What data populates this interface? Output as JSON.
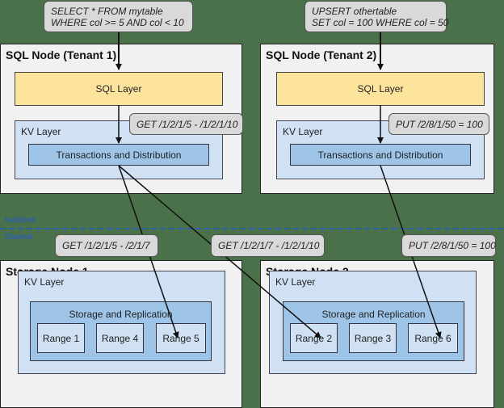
{
  "queries": {
    "tenant1": "SELECT * FROM mytable\nWHERE col >= 5 AND col < 10",
    "tenant2": "UPSERT othertable\nSET col = 100 WHERE col = 50"
  },
  "sql_nodes": [
    {
      "title": "SQL Node (Tenant 1)",
      "sql_layer": "SQL Layer",
      "kv_layer": "KV Layer",
      "transactions": "Transactions and Distribution",
      "request": "GET /1/2/1/5 - /1/2/1/10"
    },
    {
      "title": "SQL Node (Tenant 2)",
      "sql_layer": "SQL Layer",
      "kv_layer": "KV Layer",
      "transactions": "Transactions and Distribution",
      "request": "PUT /2/8/1/50 = 100"
    }
  ],
  "zones": {
    "isolated": "Isolated",
    "shared": "Shared"
  },
  "split_requests": [
    "GET /1/2/1/5 - /2/1/7",
    "GET /1/2/1/7 - /1/2/1/10",
    "PUT /2/8/1/50 = 100"
  ],
  "storage_nodes": [
    {
      "title": "Storage Node 1",
      "kv_layer": "KV Layer",
      "storage": "Storage and Replication",
      "ranges": [
        "Range 1",
        "Range 4",
        "Range 5"
      ]
    },
    {
      "title": "Storage Node 2",
      "kv_layer": "KV Layer",
      "storage": "Storage and Replication",
      "ranges": [
        "Range 2",
        "Range 3",
        "Range 6"
      ]
    }
  ],
  "colors": {
    "background": "#4a7149",
    "sql_layer": "#fde49d",
    "kv_layer": "#cfe1f3",
    "inner_layer": "#9ec4e8",
    "callout": "#d9d9d9",
    "zone_line": "#2b5fb0"
  }
}
